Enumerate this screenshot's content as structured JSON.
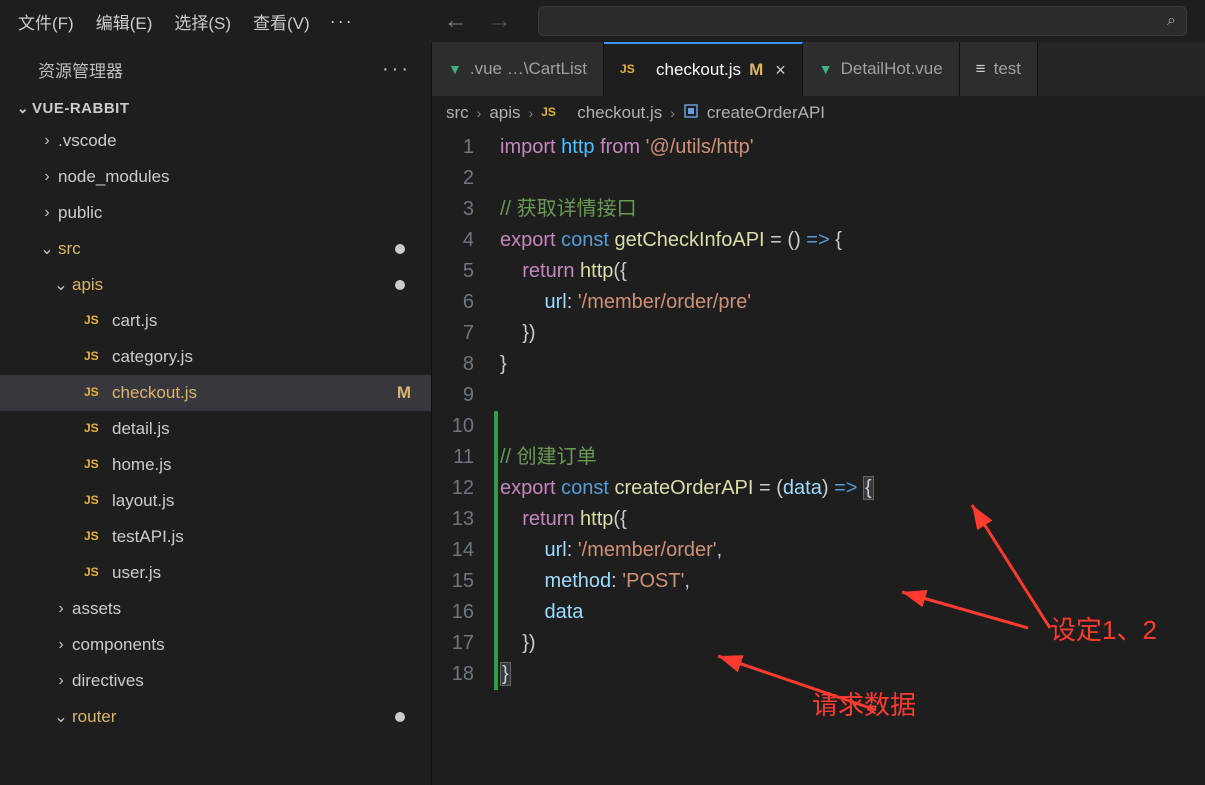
{
  "menu": {
    "file": "文件(F)",
    "edit": "编辑(E)",
    "select": "选择(S)",
    "view": "查看(V)",
    "more": "···"
  },
  "sidebar": {
    "header": "资源管理器",
    "actions": "···",
    "project": "VUE-RABBIT",
    "items": [
      {
        "kind": "folder",
        "label": ".vscode",
        "pad": 1,
        "arrow": "›"
      },
      {
        "kind": "folder",
        "label": "node_modules",
        "pad": 1,
        "arrow": "›"
      },
      {
        "kind": "folder",
        "label": "public",
        "pad": 1,
        "arrow": "›"
      },
      {
        "kind": "folder",
        "label": "src",
        "pad": 1,
        "arrow": "⌄",
        "hi": true,
        "dot": true
      },
      {
        "kind": "folder",
        "label": "apis",
        "pad": 2,
        "arrow": "⌄",
        "hi": true,
        "dot": true
      },
      {
        "kind": "js",
        "label": "cart.js",
        "pad": 3
      },
      {
        "kind": "js",
        "label": "category.js",
        "pad": 3
      },
      {
        "kind": "js",
        "label": "checkout.js",
        "pad": 3,
        "sel": true,
        "mod": true
      },
      {
        "kind": "js",
        "label": "detail.js",
        "pad": 3
      },
      {
        "kind": "js",
        "label": "home.js",
        "pad": 3
      },
      {
        "kind": "js",
        "label": "layout.js",
        "pad": 3
      },
      {
        "kind": "js",
        "label": "testAPI.js",
        "pad": 3
      },
      {
        "kind": "js",
        "label": "user.js",
        "pad": 3
      },
      {
        "kind": "folder",
        "label": "assets",
        "pad": 2,
        "arrow": "›"
      },
      {
        "kind": "folder",
        "label": "components",
        "pad": 2,
        "arrow": "›"
      },
      {
        "kind": "folder",
        "label": "directives",
        "pad": 2,
        "arrow": "›"
      },
      {
        "kind": "folder",
        "label": "router",
        "pad": 2,
        "arrow": "⌄",
        "hi": true,
        "dot": true
      }
    ]
  },
  "tabs": [
    {
      "label": ".vue …\\CartList",
      "type": "vue"
    },
    {
      "label": "checkout.js",
      "type": "js",
      "active": true,
      "mod": "M",
      "close": true
    },
    {
      "label": "DetailHot.vue",
      "type": "vue"
    },
    {
      "label": "test",
      "type": "test"
    }
  ],
  "breadcrumb": {
    "parts": [
      "src",
      "apis"
    ],
    "file": "checkout.js",
    "symbol": "createOrderAPI"
  },
  "line_numbers": [
    "1",
    "2",
    "3",
    "4",
    "5",
    "6",
    "7",
    "8",
    "9",
    "10",
    "11",
    "12",
    "13",
    "14",
    "15",
    "16",
    "17",
    "18"
  ],
  "code": {
    "l1a": "import",
    "l1b": " http ",
    "l1c": "from",
    "l1d": " '@/utils/http'",
    "l3": "// 获取详情接口",
    "l4a": "export",
    "l4b": " const",
    "l4c": " getCheckInfoAPI",
    "l4d": " = () ",
    "l4e": "=>",
    "l4f": " {",
    "l5a": "    return",
    "l5b": " http",
    "l5c": "({",
    "l6a": "        url",
    "l6b": ": ",
    "l6c": "'/member/order/pre'",
    "l7": "    })",
    "l8": "}",
    "l11": "// 创建订单",
    "l12a": "export",
    "l12b": " const",
    "l12c": " createOrderAPI",
    "l12d": " = (",
    "l12e": "data",
    "l12f": ") ",
    "l12g": "=>",
    "l12h": " ",
    "l12i": "{",
    "l13a": "    return",
    "l13b": " http",
    "l13c": "({",
    "l14a": "        url",
    "l14b": ": ",
    "l14c": "'/member/order'",
    "l14d": ",",
    "l15a": "        method",
    "l15b": ": ",
    "l15c": "'POST'",
    "l15d": ",",
    "l16": "        data",
    "l17": "    })",
    "l18": "}"
  },
  "anno": {
    "a1": "设定1、2",
    "a2": "请求数据"
  }
}
